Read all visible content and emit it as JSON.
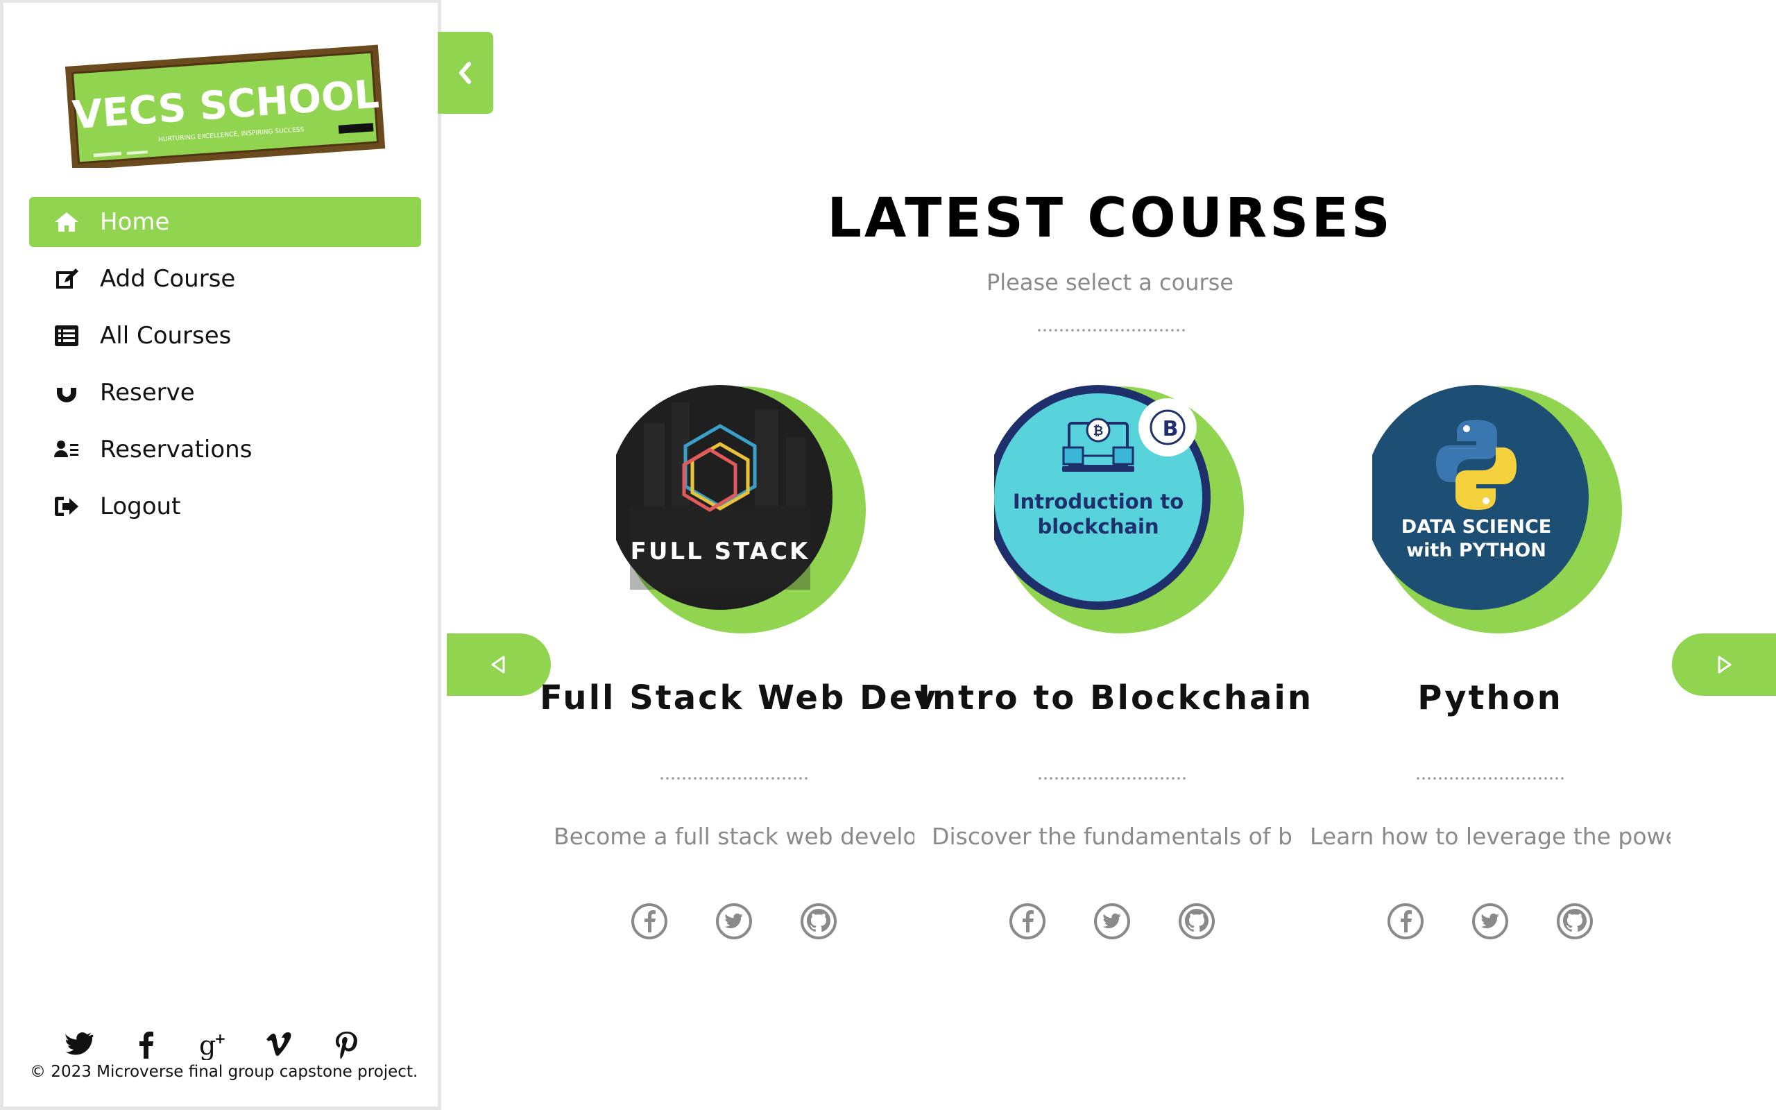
{
  "brand": {
    "logo_text": "VECS SCHOOL",
    "logo_tagline": "HURTURING EXCELLENCE, INSPIRING SUCCESS",
    "accent": "#91d44f",
    "board_frame": "#6b4a1e"
  },
  "nav": {
    "items": [
      {
        "label": "Home",
        "icon": "home-icon",
        "active": true
      },
      {
        "label": "Add Course",
        "icon": "edit-icon"
      },
      {
        "label": "All Courses",
        "icon": "list-icon"
      },
      {
        "label": "Reserve",
        "icon": "magnet-icon"
      },
      {
        "label": "Reservations",
        "icon": "user-list-icon"
      },
      {
        "label": "Logout",
        "icon": "logout-icon"
      }
    ]
  },
  "footer": {
    "social_icons": [
      "twitter-icon",
      "facebook-icon",
      "google-plus-icon",
      "vimeo-icon",
      "pinterest-icon"
    ],
    "copyright": "© 2023 Microverse final group capstone project."
  },
  "main": {
    "title": "LATEST COURSES",
    "subtitle": "Please select a course"
  },
  "courses": [
    {
      "title": "Full Stack Web Dev",
      "description": "Become a full stack web develo",
      "image_label": "FULL STACK"
    },
    {
      "title": "Intro to Blockchain",
      "description": "Discover the fundamentals of b",
      "image_label_line1": "Introduction to",
      "image_label_line2": "blockchain"
    },
    {
      "title": "Python",
      "description": "Learn how to leverage the powe",
      "image_label_line1": "DATA SCIENCE",
      "image_label_line2": "with PYTHON"
    }
  ]
}
